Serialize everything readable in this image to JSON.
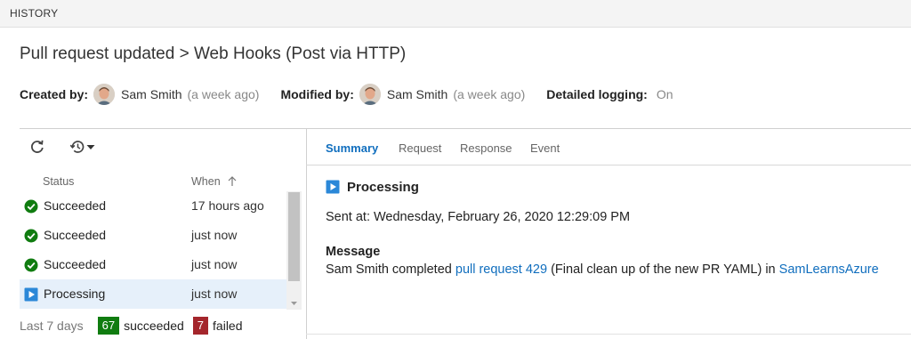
{
  "header": {
    "title": "HISTORY"
  },
  "page": {
    "title": "Pull request updated > Web Hooks (Post via HTTP)"
  },
  "meta": {
    "created_label": "Created by:",
    "created_name": "Sam Smith",
    "created_ago": "(a week ago)",
    "modified_label": "Modified by:",
    "modified_name": "Sam Smith",
    "modified_ago": "(a week ago)",
    "logging_label": "Detailed logging:",
    "logging_value": "On"
  },
  "toolbar": {
    "icons": [
      "refresh-icon",
      "history-icon",
      "caret-down-icon"
    ]
  },
  "history": {
    "columns": {
      "status": "Status",
      "when": "When"
    },
    "rows": [
      {
        "status": "Succeeded",
        "when": "17 hours ago",
        "icon": "check-circle-icon"
      },
      {
        "status": "Succeeded",
        "when": "just now",
        "icon": "check-circle-icon"
      },
      {
        "status": "Succeeded",
        "when": "just now",
        "icon": "check-circle-icon"
      },
      {
        "status": "Processing",
        "when": "just now",
        "icon": "play-square-icon",
        "selected": true
      }
    ]
  },
  "footer": {
    "period": "Last 7 days",
    "succeeded_count": "67",
    "succeeded_label": "succeeded",
    "failed_count": "7",
    "failed_label": "failed"
  },
  "tabs": [
    "Summary",
    "Request",
    "Response",
    "Event"
  ],
  "detail": {
    "status_title": "Processing",
    "sent_at": "Sent at: Wednesday, February 26, 2020 12:29:09 PM",
    "message_label": "Message",
    "message": {
      "prefix": "Sam Smith completed ",
      "pr_link": "pull request 429",
      "middle": " (Final clean up of the new PR YAML) in ",
      "repo_link": "SamLearnsAzure"
    }
  },
  "colors": {
    "accent": "#106ebe",
    "success": "#107c10",
    "failure": "#a4262c",
    "processing": "#2b88d8",
    "selected_row": "#e6f0fa"
  }
}
